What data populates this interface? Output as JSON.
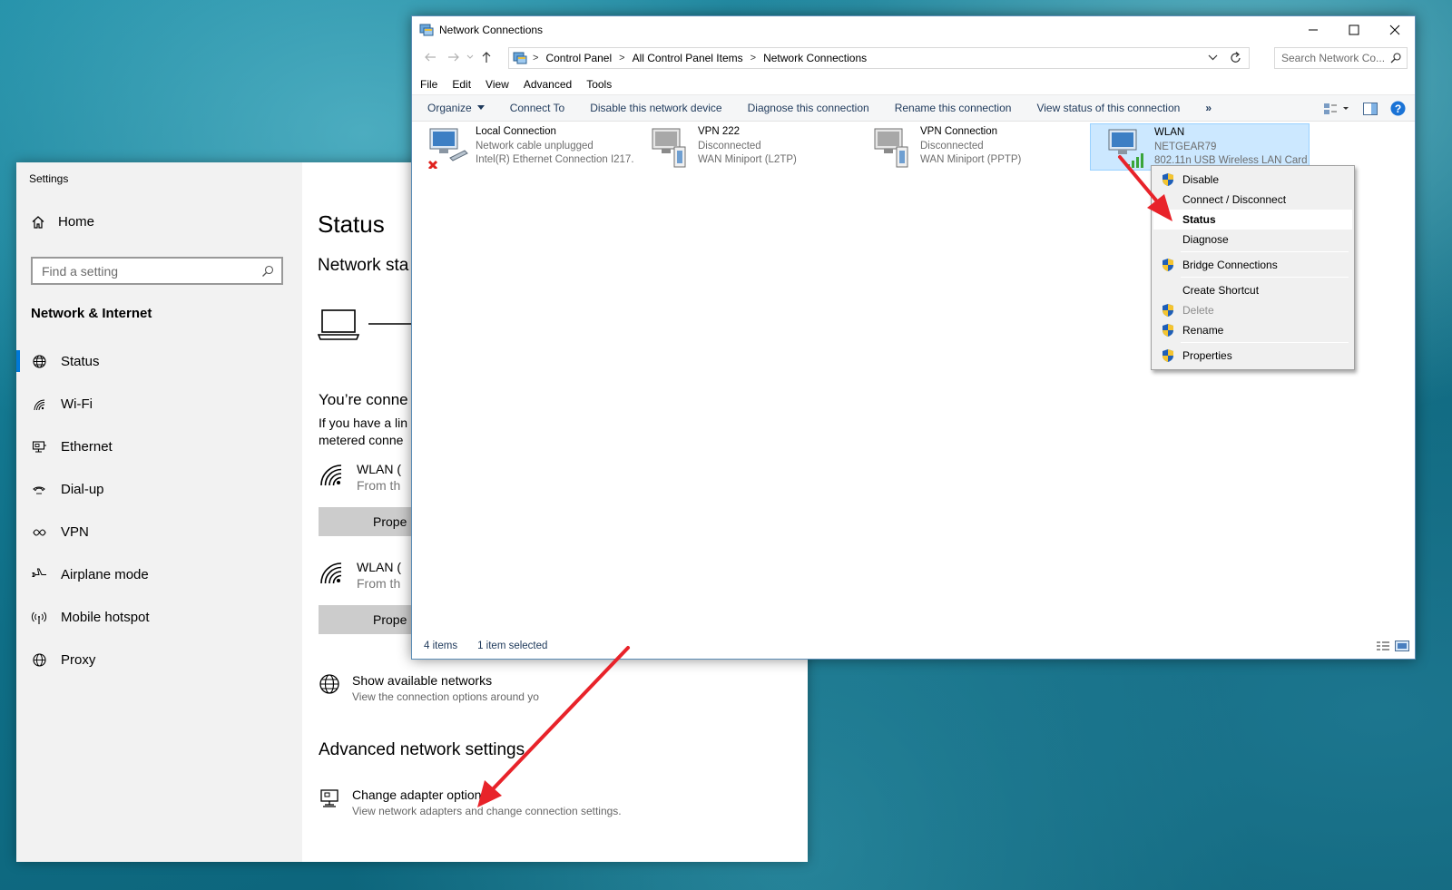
{
  "settings": {
    "window_title": "Settings",
    "home_label": "Home",
    "search_placeholder": "Find a setting",
    "section_title": "Network & Internet",
    "nav": [
      {
        "label": "Status",
        "icon": "globe-status-icon"
      },
      {
        "label": "Wi-Fi",
        "icon": "wifi-icon"
      },
      {
        "label": "Ethernet",
        "icon": "ethernet-icon"
      },
      {
        "label": "Dial-up",
        "icon": "dialup-icon"
      },
      {
        "label": "VPN",
        "icon": "vpn-icon"
      },
      {
        "label": "Airplane mode",
        "icon": "airplane-icon"
      },
      {
        "label": "Mobile hotspot",
        "icon": "hotspot-icon"
      },
      {
        "label": "Proxy",
        "icon": "globe-icon"
      }
    ],
    "main": {
      "title": "Status",
      "subtitle": "Network sta",
      "connected_heading": "You’re conne",
      "connected_text_1": "If you have a lin",
      "connected_text_2": "metered conne",
      "wlan_items": [
        {
          "title": "WLAN (",
          "subtitle": "From th",
          "button": "Prope"
        },
        {
          "title": "WLAN (",
          "subtitle": "From th",
          "button": "Prope"
        }
      ],
      "show_networks_title": "Show available networks",
      "show_networks_desc": "View the connection options around yo",
      "advanced_heading": "Advanced network settings",
      "change_adapter_title": "Change adapter options",
      "change_adapter_desc": "View network adapters and change connection settings."
    }
  },
  "netconn": {
    "window_title": "Network Connections",
    "breadcrumb": [
      "Control Panel",
      "All Control Panel Items",
      "Network Connections"
    ],
    "search_placeholder": "Search Network Co...",
    "menu": [
      "File",
      "Edit",
      "View",
      "Advanced",
      "Tools"
    ],
    "commands": {
      "organize": "Organize",
      "connect_to": "Connect To",
      "disable_device": "Disable this network device",
      "diagnose": "Diagnose this connection",
      "rename": "Rename this connection",
      "view_status": "View status of this connection",
      "more": "»"
    },
    "connections": [
      {
        "name": "Local Connection",
        "status": "Network cable unplugged",
        "device": "Intel(R) Ethernet Connection I217...",
        "selected": false
      },
      {
        "name": "VPN 222",
        "status": "Disconnected",
        "device": "WAN Miniport (L2TP)",
        "selected": false
      },
      {
        "name": "VPN Connection",
        "status": "Disconnected",
        "device": "WAN Miniport (PPTP)",
        "selected": false
      },
      {
        "name": "WLAN",
        "status": "NETGEAR79",
        "device": "802.11n USB Wireless LAN Card",
        "selected": true
      }
    ],
    "status_bar": {
      "items_count": "4 items",
      "selected_count": "1 item selected"
    }
  },
  "context_menu": {
    "items": [
      {
        "label": "Disable",
        "shield": true
      },
      {
        "label": "Connect / Disconnect",
        "shield": false
      },
      {
        "label": "Status",
        "shield": false,
        "highlighted": true
      },
      {
        "label": "Diagnose",
        "shield": false
      },
      {
        "label": "Bridge Connections",
        "shield": true
      },
      {
        "label": "Create Shortcut",
        "shield": false
      },
      {
        "label": "Delete",
        "shield": true,
        "disabled": true
      },
      {
        "label": "Rename",
        "shield": true
      },
      {
        "label": "Properties",
        "shield": true
      }
    ]
  },
  "colors": {
    "accent": "#0078d7",
    "annotation_arrow": "#e8232a",
    "selection": "#cce8ff"
  }
}
